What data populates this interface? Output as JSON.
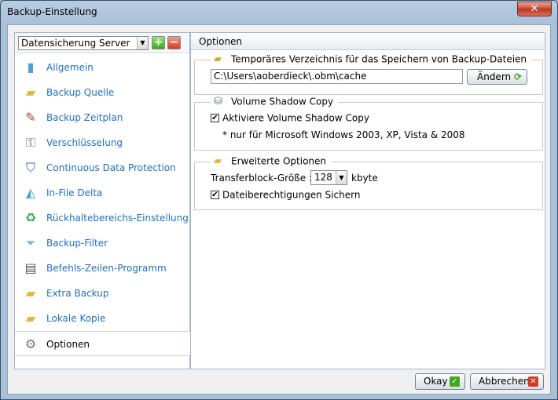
{
  "window": {
    "title": "Backup-Einstellung",
    "close_label": "✕"
  },
  "left_panel": {
    "selected_server": "Datensicherung Server",
    "add_label": "+",
    "remove_label": "−",
    "items": [
      {
        "label": "Allgemein",
        "icon": "general-icon",
        "glyph": "▮",
        "color": "#4aa0d8"
      },
      {
        "label": "Backup Quelle",
        "icon": "folder-source-icon",
        "glyph": "▰",
        "color": "#e2b73a"
      },
      {
        "label": "Backup Zeitplan",
        "icon": "calendar-icon",
        "glyph": "✎",
        "color": "#c0392b"
      },
      {
        "label": "Verschlüsselung",
        "icon": "encryption-icon",
        "glyph": "⚿",
        "color": "#666666"
      },
      {
        "label": "Continuous Data Protection",
        "icon": "shield-icon",
        "glyph": "⛉",
        "color": "#3568b8"
      },
      {
        "label": "In-File Delta",
        "icon": "delta-file-icon",
        "glyph": "◭",
        "color": "#4aa0d8"
      },
      {
        "label": "Rückhaltebereichs-Einstellung",
        "icon": "recycle-bin-icon",
        "glyph": "♻",
        "color": "#3aa35b"
      },
      {
        "label": "Backup-Filter",
        "icon": "filter-icon",
        "glyph": "⏷",
        "color": "#8fb8d8"
      },
      {
        "label": "Befehls-Zeilen-Programm",
        "icon": "command-line-icon",
        "glyph": "▤",
        "color": "#555555"
      },
      {
        "label": "Extra Backup",
        "icon": "extra-backup-icon",
        "glyph": "▰",
        "color": "#e2b73a"
      },
      {
        "label": "Lokale Kopie",
        "icon": "local-copy-icon",
        "glyph": "▰",
        "color": "#e2b73a"
      },
      {
        "label": "Optionen",
        "icon": "options-gear-icon",
        "glyph": "⚙",
        "color": "#777777"
      }
    ],
    "selected_index": 11
  },
  "right_panel": {
    "header": "Optionen",
    "temp_dir": {
      "title": "Temporäres Verzeichnis für das Speichern von Backup-Dateien",
      "path": "C:\\Users\\aoberdieck\\.obm\\cache",
      "change_label": "Ändern"
    },
    "vss": {
      "title": "Volume Shadow Copy",
      "enable_label": "Aktiviere Volume Shadow Copy",
      "note": "* nur für Microsoft Windows 2003, XP, Vista & 2008"
    },
    "advanced": {
      "title": "Erweiterte Optionen",
      "transfer_label": "Transferblock-Größe :",
      "transfer_value": "128",
      "transfer_unit": "kbyte",
      "permissions_label": "Dateiberechtigungen Sichern"
    }
  },
  "footer": {
    "ok_label": "Okay",
    "cancel_label": "Abbrechen"
  },
  "colors": {
    "link_blue": "#1e6fc0",
    "ok_green": "#3ea81f",
    "cancel_red": "#d23a22"
  }
}
